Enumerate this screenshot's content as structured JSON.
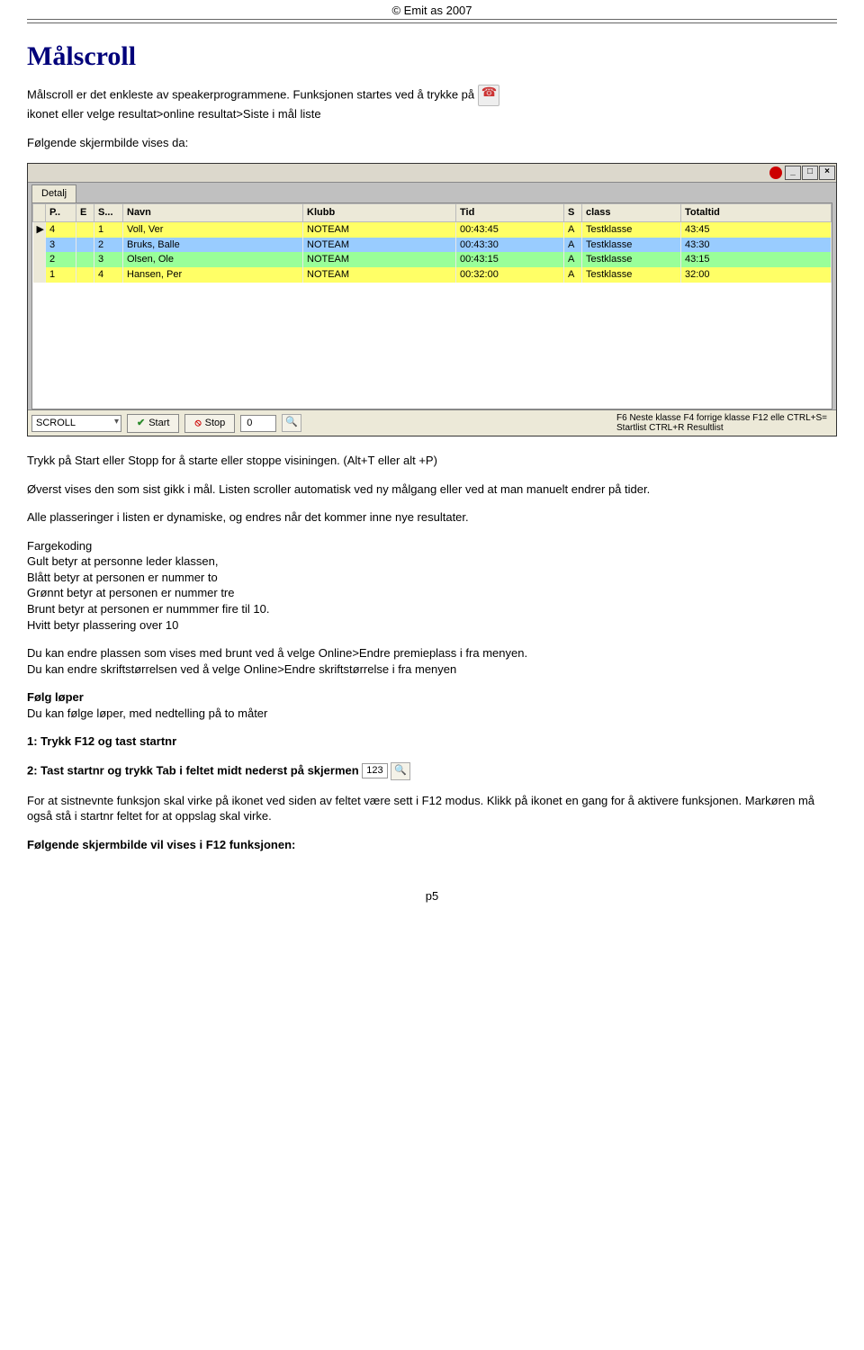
{
  "header": {
    "copyright": "© Emit as 2007"
  },
  "title": "Målscroll",
  "intro": {
    "line1a": "Målscroll er det enkleste av speakerprogrammene. Funksjonen startes ved å trykke på ",
    "line1b": "ikonet eller velge resultat>online resultat>Siste i mål liste",
    "line2": "Følgende skjermbilde vises da:"
  },
  "screenshot": {
    "tab": "Detalj",
    "sys": {
      "min": "_",
      "max": "□",
      "close": "×"
    },
    "headers": [
      "",
      "P..",
      "E",
      "S...",
      "Navn",
      "Klubb",
      "Tid",
      "S",
      "class",
      "Totaltid"
    ],
    "rows": [
      {
        "marker": "▶",
        "p": "4",
        "e": "",
        "s": "1",
        "navn": "Voll, Ver",
        "klubb": "NOTEAM",
        "tid": "00:43:45",
        "st": "A",
        "class": "Testklasse",
        "totaltid": "43:45",
        "color": "row-yellow"
      },
      {
        "marker": "",
        "p": "3",
        "e": "",
        "s": "2",
        "navn": "Bruks, Balle",
        "klubb": "NOTEAM",
        "tid": "00:43:30",
        "st": "A",
        "class": "Testklasse",
        "totaltid": "43:30",
        "color": "row-blue"
      },
      {
        "marker": "",
        "p": "2",
        "e": "",
        "s": "3",
        "navn": "Olsen, Ole",
        "klubb": "NOTEAM",
        "tid": "00:43:15",
        "st": "A",
        "class": "Testklasse",
        "totaltid": "43:15",
        "color": "row-green"
      },
      {
        "marker": "",
        "p": "1",
        "e": "",
        "s": "4",
        "navn": "Hansen, Per",
        "klubb": "NOTEAM",
        "tid": "00:32:00",
        "st": "A",
        "class": "Testklasse",
        "totaltid": "32:00",
        "color": "row-yellow"
      }
    ],
    "status": {
      "combo": "SCROLL",
      "start": "Start",
      "stop": "Stop",
      "num": "0",
      "hint": "F6 Neste klasse F4 forrige klasse  F12 elle CTRL+S= Startlist  CTRL+R Resultlist"
    }
  },
  "afterShot": {
    "p1": "Trykk på Start eller Stopp for å starte eller stoppe visiningen. (Alt+T eller alt +P)",
    "p2": "Øverst vises den som sist gikk i mål. Listen scroller automatisk ved ny målgang eller ved at man manuelt endrer på tider.",
    "p3": "Alle plasseringer i listen er dynamiske, og endres når det kommer inne nye resultater.",
    "colorHead": "Fargekoding",
    "c1": "Gult betyr at personne leder klassen,",
    "c2": "Blått betyr at personen er nummer to",
    "c3": "Grønnt betyr at personen er nummer tre",
    "c4": "Brunt betyr at personen er nummmer fire til 10.",
    "c5": "Hvitt betyr plassering over 10",
    "p4a": "Du kan endre plassen som vises med brunt ved å velge ",
    "p4b": "Online>Endre premieplass",
    "p4c": " i fra menyen.",
    "p5a": "Du kan endre skriftstørrelsen ved å velge ",
    "p5b": "Online>Endre skriftstørrelse",
    "p5c": " i fra menyen",
    "folgHead": "Følg løper",
    "folgText": "Du kan følge løper, med nedtelling på to måter",
    "opt1": "1: Trykk F12 og tast startnr",
    "opt2": "2: Tast startnr og trykk Tab i feltet midt nederst på skjermen",
    "inlineField": "123",
    "p6": "For at sistnevnte funksjon skal virke på ikonet ved siden av feltet være sett i F12 modus. Klikk på ikonet en gang for å aktivere funksjonen. Markøren må også stå i startnr feltet for at oppslag skal virke.",
    "finalHead": "Følgende skjermbilde vil vises i F12 funksjonen:"
  },
  "footer": {
    "page": "p5"
  }
}
